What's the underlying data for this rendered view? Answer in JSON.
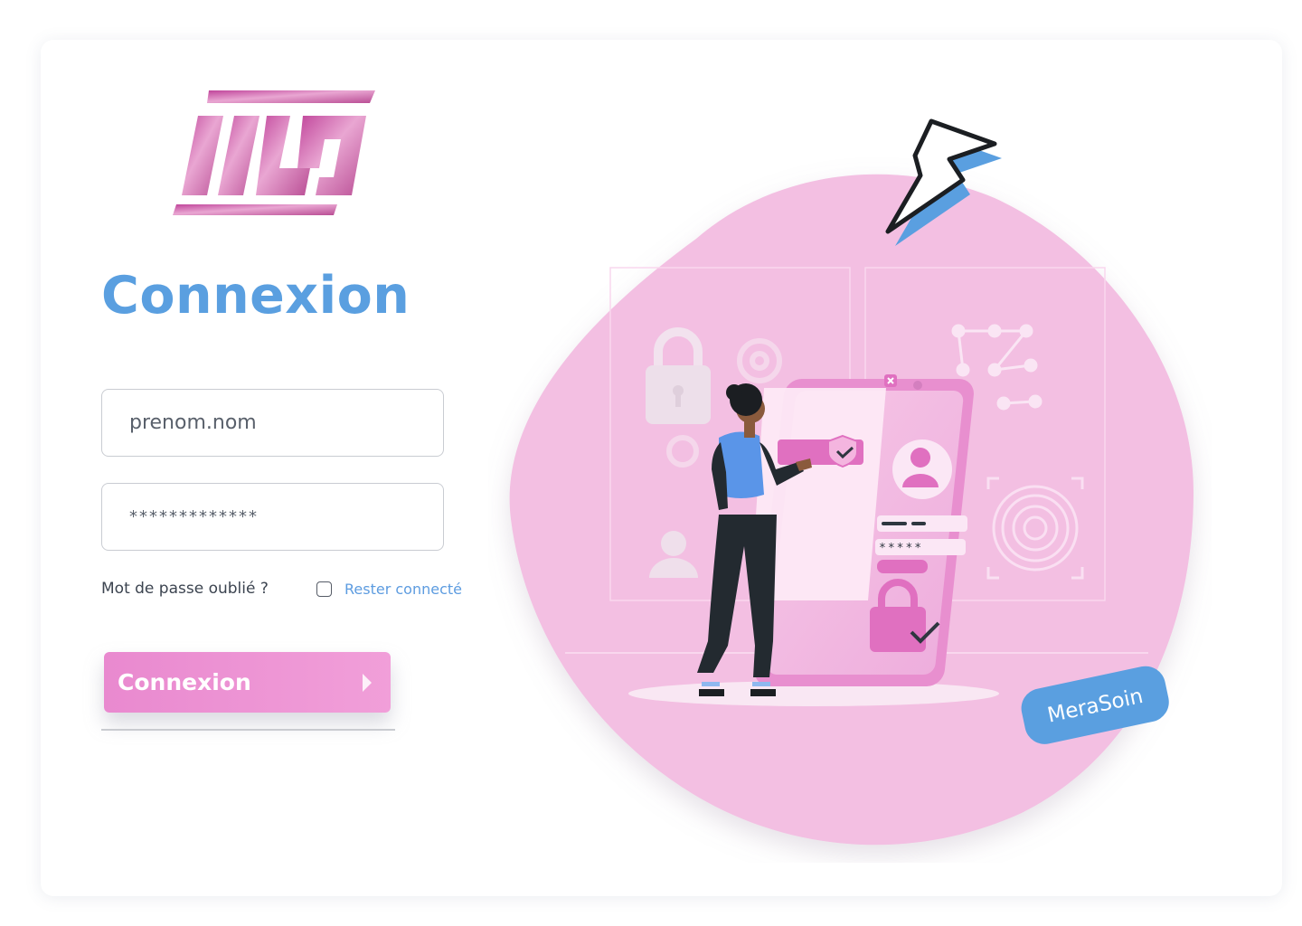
{
  "brand": {
    "logo_name": "MS",
    "logo_colors": [
      "#c0449a",
      "#e9a0cf",
      "#b94d94"
    ],
    "badge_text": "MeraSoin"
  },
  "login": {
    "title": "Connexion",
    "username": {
      "value": "prenom.nom",
      "placeholder": "prenom.nom"
    },
    "password": {
      "value": "*************"
    },
    "forgot_label": "Mot de passe oublié ?",
    "remember_label": "Rester connecté",
    "remember_checked": false,
    "submit_label": "Connexion"
  },
  "illustration": {
    "phone_password_mask": "*****"
  },
  "colors": {
    "accent_blue": "#5a9fe0",
    "accent_pink": "#ec8fd4",
    "blob_pink": "#f3bfe2"
  }
}
